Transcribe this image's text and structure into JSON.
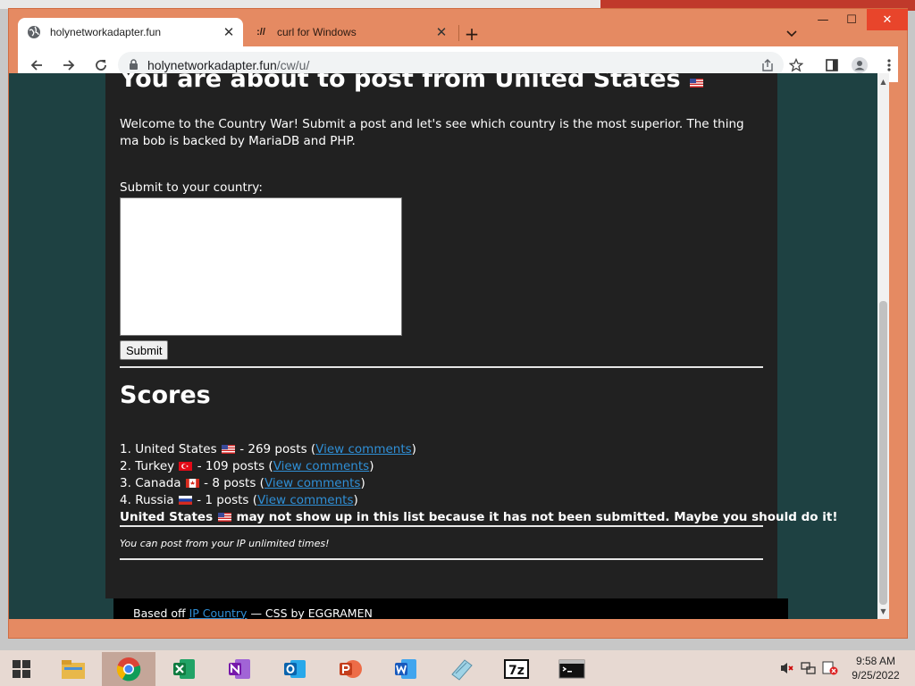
{
  "browser": {
    "tabs": [
      {
        "title": "holynetworkadapter.fun",
        "active": true
      },
      {
        "title": "curl for Windows",
        "active": false
      }
    ],
    "url_host": "holynetworkadapter.fun",
    "url_path": "/cw/u/",
    "window_controls": {
      "minimize": "—",
      "maximize": "☐",
      "close": "✕"
    },
    "colors": {
      "frame": "#e58a62",
      "close_button": "#e8452b"
    }
  },
  "page": {
    "heading": "You are about to post from United States",
    "welcome": "Welcome to the Country War! Submit a post and let's see which country is the most superior. The thing ma bob is backed by MariaDB and PHP.",
    "submit_label": "Submit to your country:",
    "textarea_value": "",
    "submit_button": "Submit",
    "scores_heading": "Scores",
    "scores": [
      {
        "rank": "1.",
        "country": "United States",
        "flag": "us",
        "count_text": "- 269 posts (",
        "link": "View comments",
        "close": ")"
      },
      {
        "rank": "2.",
        "country": "Turkey",
        "flag": "tr",
        "count_text": "- 109 posts (",
        "link": "View comments",
        "close": ")"
      },
      {
        "rank": "3.",
        "country": "Canada",
        "flag": "ca",
        "count_text": "- 8 posts (",
        "link": "View comments",
        "close": ")"
      },
      {
        "rank": "4.",
        "country": "Russia",
        "flag": "ru",
        "count_text": "- 1 posts (",
        "link": "View comments",
        "close": ")"
      }
    ],
    "note_country": "United States",
    "note_text": "may not show up in this list because it has not been submitted. Maybe you should do it!",
    "italic_note": "You can post from your IP unlimited times!",
    "colors": {
      "background": "#1e4142",
      "panel": "#212121",
      "link": "#2f8fd6"
    }
  },
  "footer": {
    "prefix": "Based off",
    "link": "IP Country",
    "suffix": "— CSS by EGGRAMEN"
  },
  "taskbar": {
    "apps": [
      "file-explorer",
      "chrome",
      "excel",
      "onenote",
      "outlook",
      "powerpoint",
      "word",
      "notepad",
      "7zip",
      "command-prompt"
    ],
    "time": "9:58 AM",
    "date": "9/25/2022"
  }
}
